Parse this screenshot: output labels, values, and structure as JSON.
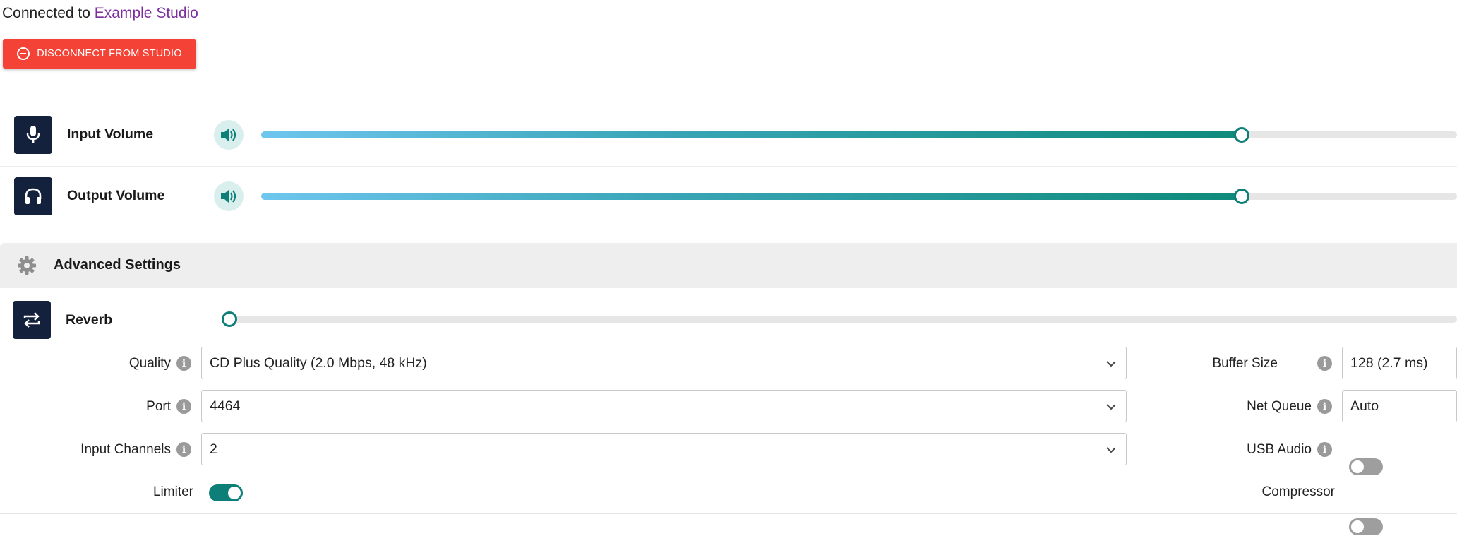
{
  "connection": {
    "prefix": "Connected to",
    "studio_name": "Example Studio"
  },
  "disconnect_button": {
    "label": "DISCONNECT FROM STUDIO",
    "color": "#f44336"
  },
  "volumes": {
    "input": {
      "label": "Input Volume",
      "level": 0.82
    },
    "output": {
      "label": "Output Volume",
      "level": 0.82
    }
  },
  "advanced": {
    "title": "Advanced Settings",
    "reverb": {
      "label": "Reverb",
      "level": 0.0
    },
    "quality": {
      "label": "Quality",
      "value": "CD Plus Quality (2.0 Mbps, 48 kHz)"
    },
    "port": {
      "label": "Port",
      "value": "4464"
    },
    "input_channels": {
      "label": "Input Channels",
      "value": "2"
    },
    "limiter": {
      "label": "Limiter",
      "on": true
    },
    "buffer_size": {
      "label": "Buffer Size",
      "value": "128 (2.7 ms)"
    },
    "net_queue": {
      "label": "Net Queue",
      "value": "Auto"
    },
    "usb_audio": {
      "label": "USB Audio",
      "on": false
    },
    "compressor": {
      "label": "Compressor",
      "on": false
    }
  },
  "icons": {
    "info": "i",
    "microphone": "microphone-icon",
    "headphones": "headphones-icon",
    "volume": "volume-icon",
    "gear": "gear-icon",
    "repeat": "repeat-icon",
    "chevron": "chevron-down-icon"
  },
  "colors": {
    "accent": "#0e7f78",
    "icon_box": "#14213d",
    "studio_link": "#7b2f9e"
  }
}
